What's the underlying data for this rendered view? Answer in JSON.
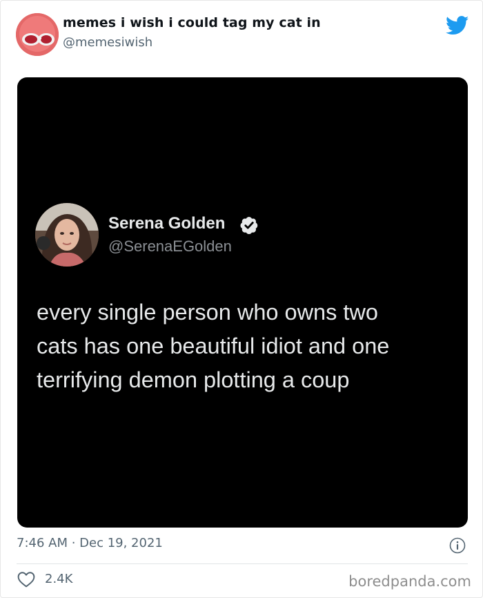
{
  "tweet": {
    "display_name": "memes i wish i could tag my cat in",
    "handle": "@memesiwish",
    "timestamp": "7:46 AM · Dec 19, 2021",
    "likes": "2.4K"
  },
  "embedded": {
    "display_name": "Serena Golden",
    "handle": "@SerenaEGolden",
    "lines": [
      "every single person who owns two",
      "cats has one beautiful idiot and one",
      "terrifying demon plotting a coup"
    ]
  },
  "watermark": "boredpanda.com",
  "icons": {
    "logo": "twitter-bird-icon",
    "verified": "verified-badge-icon",
    "info": "info-icon",
    "like": "heart-icon"
  },
  "colors": {
    "twitter_blue": "#1d9bf0",
    "text_primary": "#0f1419",
    "text_secondary": "#536471",
    "media_background": "#000000"
  }
}
